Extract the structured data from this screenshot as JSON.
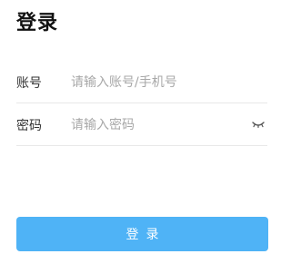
{
  "header": {
    "title": "登录"
  },
  "form": {
    "account": {
      "label": "账号",
      "value": "",
      "placeholder": "请输入账号/手机号"
    },
    "password": {
      "label": "密码",
      "value": "",
      "placeholder": "请输入密码",
      "visibility_icon": "eye-closed-icon"
    }
  },
  "actions": {
    "login_label": "登录"
  },
  "colors": {
    "primary_button": "#4fb3f6",
    "divider": "#e8e8e8",
    "placeholder": "#a8a8a8"
  }
}
